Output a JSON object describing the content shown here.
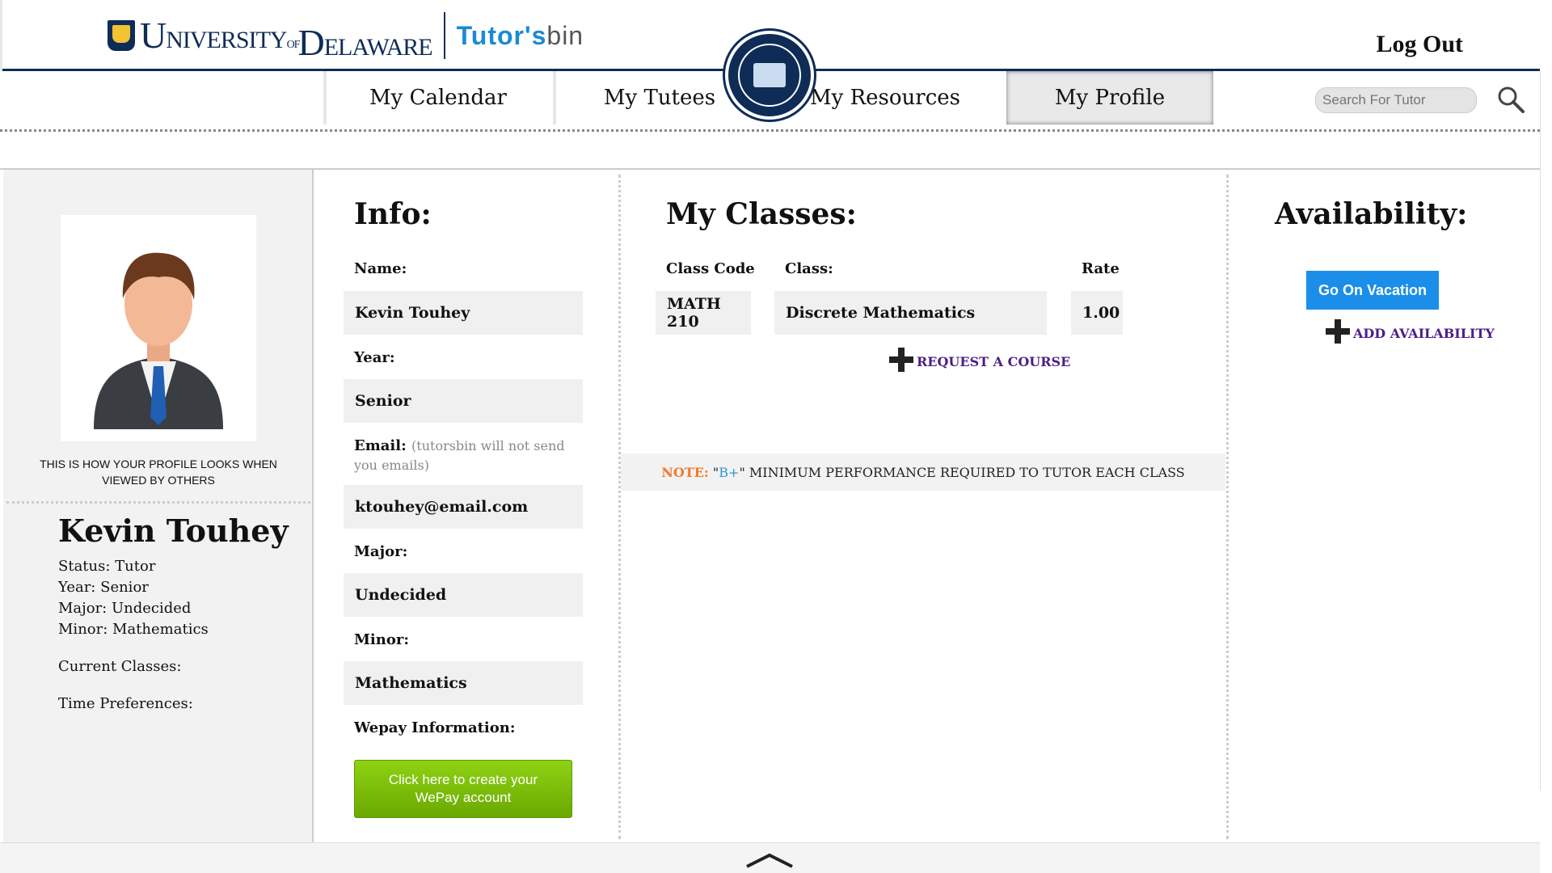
{
  "header": {
    "logo_ud_line1": "NIVERSITY",
    "logo_ud_of": "OF",
    "logo_ud_line2": "ELAWARE",
    "logo_ud_u": "U",
    "logo_ud_d": "D",
    "logo_tutors": "Tutor's",
    "logo_bin": "bin",
    "logout_label": "Log Out"
  },
  "nav": {
    "tabs": [
      {
        "label": "My Calendar"
      },
      {
        "label": "My Tutees"
      },
      {
        "label": "My Resources"
      },
      {
        "label": "My Profile"
      }
    ],
    "active_tab": "My Profile",
    "search_placeholder": "Search For Tutor"
  },
  "profile_card": {
    "caption": "This is how your profile looks when viewed by others",
    "name": "Kevin Touhey",
    "status_label": "Status:",
    "status": "Tutor",
    "year_label": "Year:",
    "year": "Senior",
    "major_label": "Major:",
    "major": "Undecided",
    "minor_label": "Minor:",
    "minor": "Mathematics",
    "current_classes_label": "Current Classes:",
    "time_prefs_label": "Time Preferences:"
  },
  "info": {
    "heading": "Info:",
    "name_label": "Name:",
    "name": "Kevin Touhey",
    "year_label": "Year:",
    "year": "Senior",
    "email_label": "Email:",
    "email_note": "(tutorsbin will not send you emails)",
    "email": "ktouhey@email.com",
    "major_label": "Major:",
    "major": "Undecided",
    "minor_label": "Minor:",
    "minor": "Mathematics",
    "wepay_label": "Wepay Information:",
    "wepay_button": "Click here to create your WePay account"
  },
  "classes": {
    "heading": "My Classes:",
    "columns": [
      "Class Code",
      "Class:",
      "Rate"
    ],
    "rows": [
      {
        "code": "MATH 210",
        "name": "Discrete Mathematics",
        "rate": "1.00"
      }
    ],
    "request_label": "Request a course",
    "note_prefix": "NOTE:",
    "note_quote_open": "\"",
    "note_grade": "B+",
    "note_rest": "\" MINIMUM PERFORMANCE REQUIRED TO TUTOR EACH CLASS"
  },
  "availability": {
    "heading": "Availability:",
    "vacation_button": "Go On Vacation",
    "add_label": "Add availability"
  },
  "colors": {
    "brand_navy": "#0f2c57",
    "brand_blue": "#1b8ad6",
    "link_purple": "#4b1f86",
    "wepay_green": "#7cbd0a",
    "note_orange": "#f07a2b"
  }
}
